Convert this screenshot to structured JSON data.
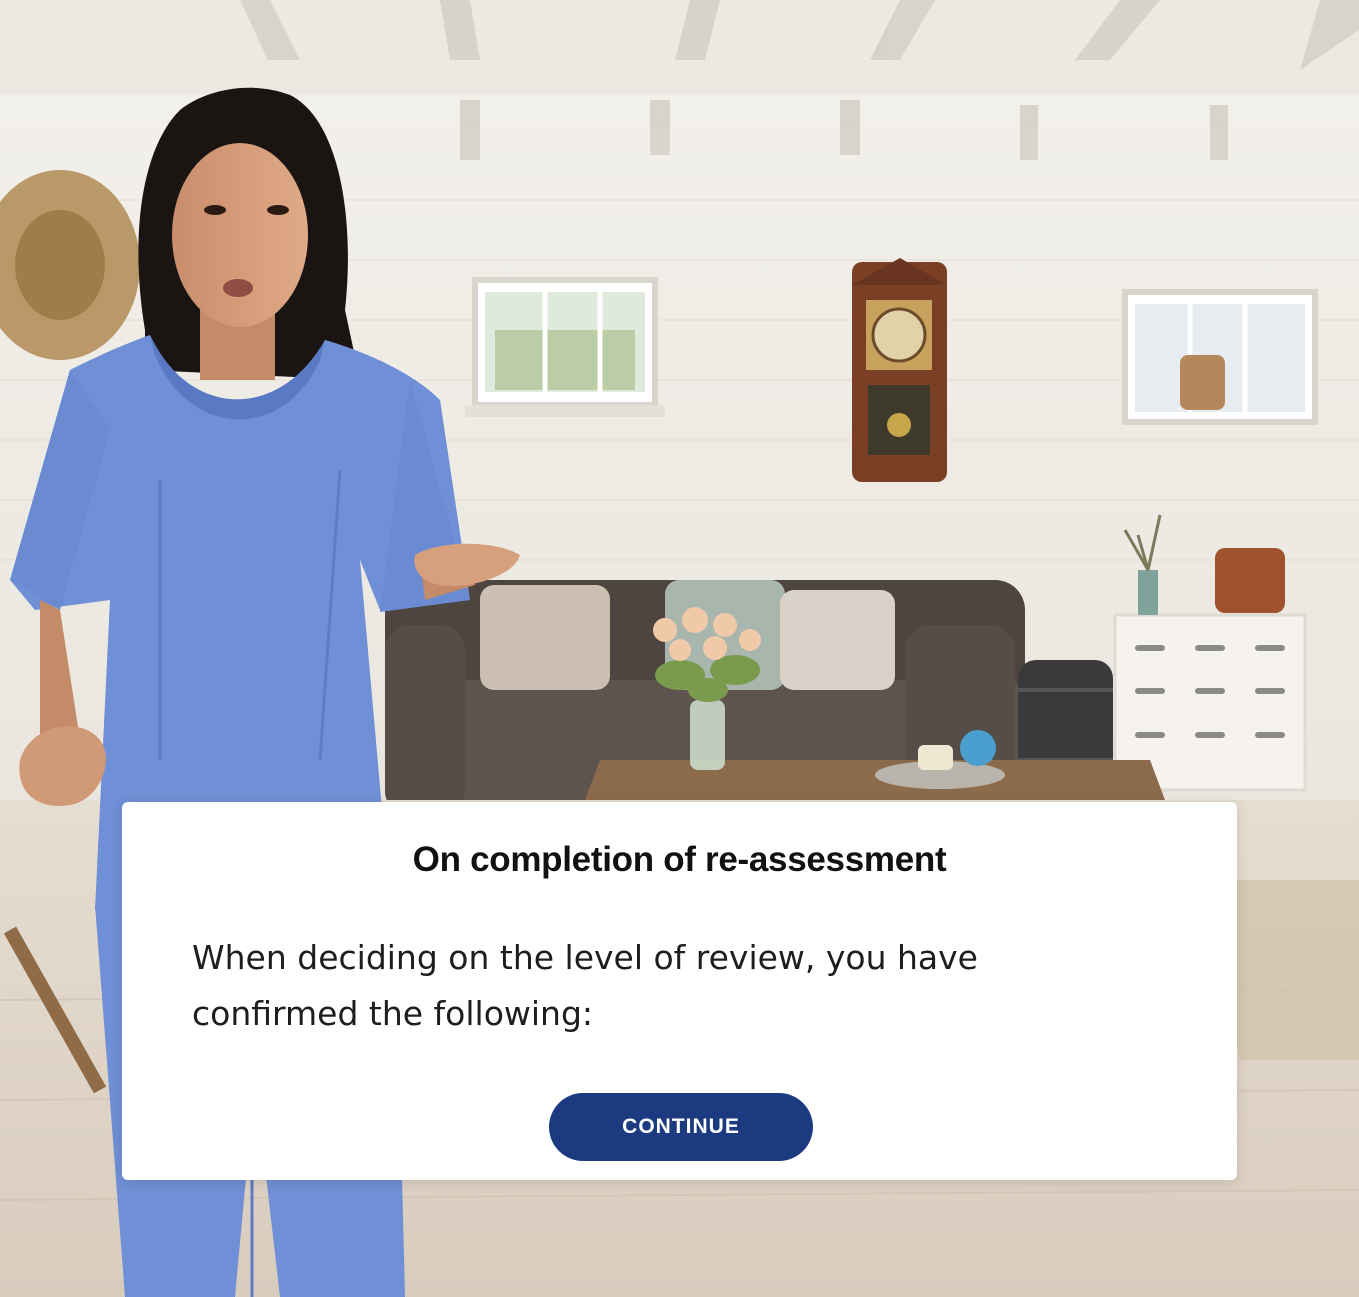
{
  "dialog": {
    "title": "On completion of re-assessment",
    "body": "When deciding on the level of review, you have confirmed the following:",
    "continue_label": "CONTINUE"
  },
  "colors": {
    "button_bg": "#1c3a80",
    "button_text": "#ffffff",
    "dialog_bg": "#ffffff",
    "scrubs": "#6f8fd6"
  }
}
